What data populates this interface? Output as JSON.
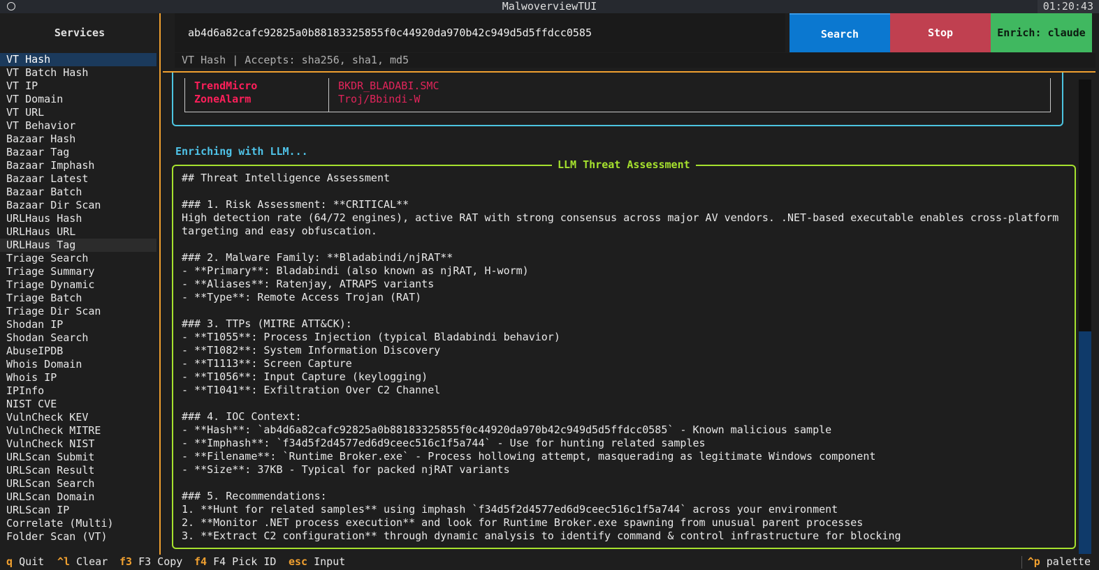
{
  "window": {
    "title": "MalwoverviewTUI",
    "clock": "01:20:43"
  },
  "sidebar": {
    "header": "Services",
    "items": [
      "VT Hash",
      "VT Batch Hash",
      "VT IP",
      "VT Domain",
      "VT URL",
      "VT Behavior",
      "Bazaar Hash",
      "Bazaar Tag",
      "Bazaar Imphash",
      "Bazaar Latest",
      "Bazaar Batch",
      "Bazaar Dir Scan",
      "URLHaus Hash",
      "URLHaus URL",
      "URLHaus Tag",
      "Triage Search",
      "Triage Summary",
      "Triage Dynamic",
      "Triage Batch",
      "Triage Dir Scan",
      "Shodan IP",
      "Shodan Search",
      "AbuseIPDB",
      "Whois Domain",
      "Whois IP",
      "IPInfo",
      "NIST CVE",
      "VulnCheck KEV",
      "VulnCheck MITRE",
      "VulnCheck NIST",
      "URLScan Submit",
      "URLScan Result",
      "URLScan Search",
      "URLScan Domain",
      "URLScan IP",
      "Correlate (Multi)",
      "Folder Scan (VT)"
    ],
    "active_index": 0,
    "hover_index": 14
  },
  "search": {
    "value": "ab4d6a82cafc92825a0b88183325855f0c44920da970b42c949d5d5ffdcc0585",
    "hint": "VT Hash | Accepts: sha256, sha1, md5"
  },
  "buttons": {
    "search": "Search",
    "stop": "Stop",
    "enrich": "Enrich: claude"
  },
  "av_results": [
    {
      "vendor": "TrendMicro",
      "result": "BKDR_BLADABI.SMC"
    },
    {
      "vendor": "ZoneAlarm",
      "result": "Troj/Bbindi-W"
    }
  ],
  "status": "Enriching with LLM...",
  "llm": {
    "title": "LLM Threat Assessment",
    "lines": [
      "## Threat Intelligence Assessment",
      "",
      "### 1. Risk Assessment: **CRITICAL**",
      "High detection rate (64/72 engines), active RAT with strong consensus across major AV vendors. .NET-based executable enables cross-platform",
      "targeting and easy obfuscation.",
      "",
      "### 2. Malware Family: **Bladabindi/njRAT**",
      "- **Primary**: Bladabindi (also known as njRAT, H-worm)",
      "- **Aliases**: Ratenjay, ATRAPS variants",
      "- **Type**: Remote Access Trojan (RAT)",
      "",
      "### 3. TTPs (MITRE ATT&CK):",
      "- **T1055**: Process Injection (typical Bladabindi behavior)",
      "- **T1082**: System Information Discovery",
      "- **T1113**: Screen Capture",
      "- **T1056**: Input Capture (keylogging)",
      "- **T1041**: Exfiltration Over C2 Channel",
      "",
      "### 4. IOC Context:",
      "- **Hash**: `ab4d6a82cafc92825a0b88183325855f0c44920da970b42c949d5d5ffdcc0585` - Known malicious sample",
      "- **Imphash**: `f34d5f2d4577ed6d9ceec516c1f5a744` - Use for hunting related samples",
      "- **Filename**: `Runtime Broker.exe` - Process hollowing attempt, masquerading as legitimate Windows component",
      "- **Size**: 37KB - Typical for packed njRAT variants",
      "",
      "### 5. Recommendations:",
      "1. **Hunt for related samples** using imphash `f34d5f2d4577ed6d9ceec516c1f5a744` across your environment",
      "2. **Monitor .NET process execution** and look for Runtime Broker.exe spawning from unusual parent processes",
      "3. **Extract C2 configuration** through dynamic analysis to identify command & control infrastructure for blocking"
    ]
  },
  "footer": {
    "bindings": [
      {
        "key": "q",
        "label": "Quit"
      },
      {
        "key": "^l",
        "label": "Clear"
      },
      {
        "key": "f3",
        "label": "F3 Copy"
      },
      {
        "key": "f4",
        "label": "F4 Pick ID"
      },
      {
        "key": "esc",
        "label": "Input"
      }
    ],
    "palette_key": "^p",
    "palette_label": "palette"
  },
  "colors": {
    "accent": "#f0a030",
    "search_button": "#0b78d0",
    "stop_button": "#c04050",
    "enrich_button": "#40b860",
    "av_box_border": "#4cc4e0",
    "llm_box_border": "#a6e22e",
    "detection_red": "#ff1f5a"
  }
}
